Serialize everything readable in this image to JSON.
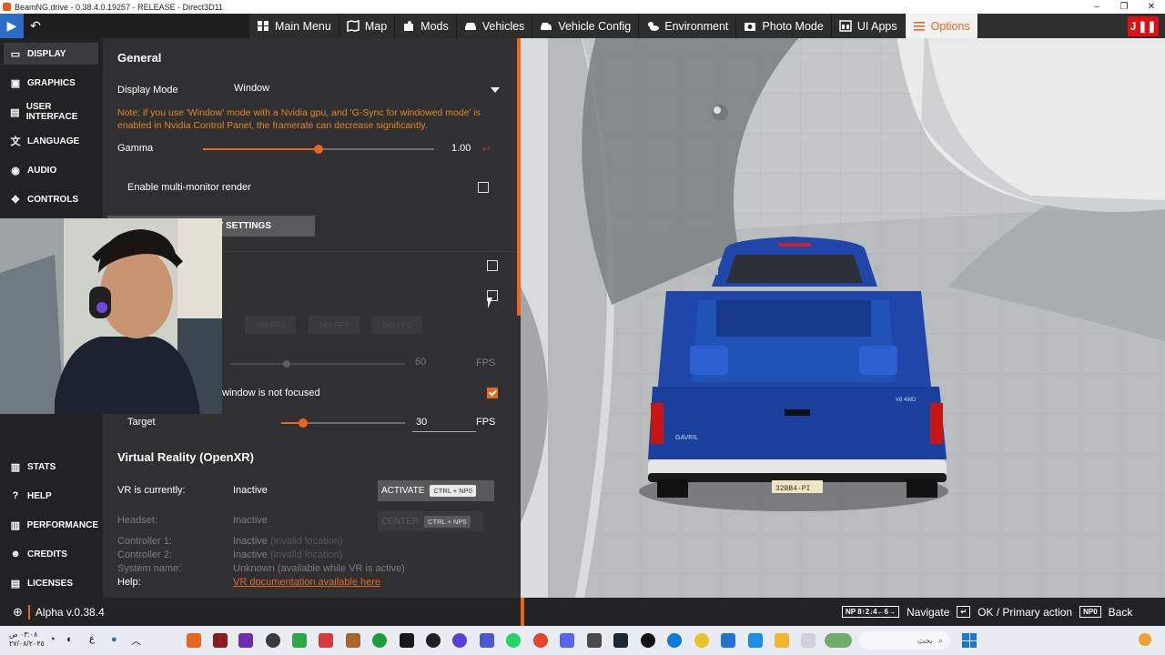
{
  "window": {
    "title": "BeamNG.drive - 0.38.4.0.19257 - RELEASE - Direct3D11",
    "controls": [
      "–",
      "❐",
      "✕"
    ]
  },
  "topnav": {
    "items": [
      {
        "label": "Main Menu",
        "icon": "grid-icon"
      },
      {
        "label": "Map",
        "icon": "map-icon"
      },
      {
        "label": "Mods",
        "icon": "puzzle-icon"
      },
      {
        "label": "Vehicles",
        "icon": "car-icon"
      },
      {
        "label": "Vehicle Config",
        "icon": "car-wrench-icon"
      },
      {
        "label": "Environment",
        "icon": "weather-icon"
      },
      {
        "label": "Photo Mode",
        "icon": "camera-icon"
      },
      {
        "label": "UI Apps",
        "icon": "ui-apps-icon"
      },
      {
        "label": "Options",
        "icon": "sliders-icon",
        "active": true
      }
    ],
    "right_badge": "J"
  },
  "sidebar": {
    "top": [
      {
        "label": "DISPLAY",
        "icon": "monitor-icon",
        "active": true
      },
      {
        "label": "GRAPHICS",
        "icon": "image-icon"
      },
      {
        "label": "USER INTERFACE",
        "icon": "window-icon"
      },
      {
        "label": "LANGUAGE",
        "icon": "translate-icon"
      },
      {
        "label": "AUDIO",
        "icon": "speaker-icon"
      },
      {
        "label": "CONTROLS",
        "icon": "controls-icon"
      }
    ],
    "bottom": [
      {
        "label": "STATS",
        "icon": "stats-icon"
      },
      {
        "label": "HELP",
        "icon": "help-icon"
      },
      {
        "label": "PERFORMANCE",
        "icon": "performance-icon"
      },
      {
        "label": "CREDITS",
        "icon": "credits-icon"
      },
      {
        "label": "LICENSES",
        "icon": "licenses-icon"
      }
    ]
  },
  "general": {
    "heading": "General",
    "display_mode_label": "Display Mode",
    "display_mode_value": "Window",
    "note": "Note: if you use 'Window' mode with a Nvidia gpu, and 'G-Sync for windowed mode' is enabled in Nvidia Control Panel, the framerate can decrease significantly.",
    "gamma_label": "Gamma",
    "gamma_value": "1.00",
    "gamma_level": 0.5,
    "multi_monitor_label": "Enable multi-monitor render",
    "multi_monitor_checked": false,
    "button_partial": "Y SETTINGS"
  },
  "framerate": {
    "chips": [
      "120 FPS",
      "144 FPS",
      "240 FPS"
    ],
    "limit_value": "60",
    "limit_unit": "FPS",
    "unfocused_label": "window is not focused",
    "unfocused_checked": true,
    "target_label": "Target",
    "target_value": "30",
    "target_unit": "FPS",
    "target_level": 0.18
  },
  "vr": {
    "heading": "Virtual Reality (OpenXR)",
    "status_label": "VR is currently:",
    "status_value": "Inactive",
    "activate_label": "ACTIVATE",
    "activate_key": "CTRL + NP0",
    "headset_label": "Headset:",
    "headset_value": "Inactive",
    "center_label": "CENTER",
    "center_key": "CTRL + NP5",
    "controller1_label": "Controller 1:",
    "controller1_value": "Inactive",
    "controller1_note": "(invalid location)",
    "controller2_label": "Controller 2:",
    "controller2_value": "Inactive",
    "controller2_note": "(invalid location)",
    "system_label": "System name:",
    "system_value": "Unknown (available while VR is active)",
    "help_label": "Help:",
    "help_link": "VR documentation available here"
  },
  "bottombar": {
    "version": "Alpha v.0.38.4",
    "nav_keys": "NP 8↑2↓4←6→",
    "navigate_label": "Navigate",
    "ok_label": "OK / Primary action",
    "back_key": "NP0",
    "back_label": "Back"
  },
  "vehicle": {
    "badge": "GAVRIL",
    "plate": "32BB4-PI",
    "engine_badge": "V8 4WD"
  },
  "taskbar": {
    "time": "٠٣:٠٨ ص",
    "date": "٢٧/٠٨/٢٠٢٥",
    "lang": "ع",
    "search_placeholder": "بحث"
  },
  "colors": {
    "accent": "#e8661c",
    "panel": "#303032",
    "sidebar": "#222224",
    "truck": "#1f46a8"
  }
}
